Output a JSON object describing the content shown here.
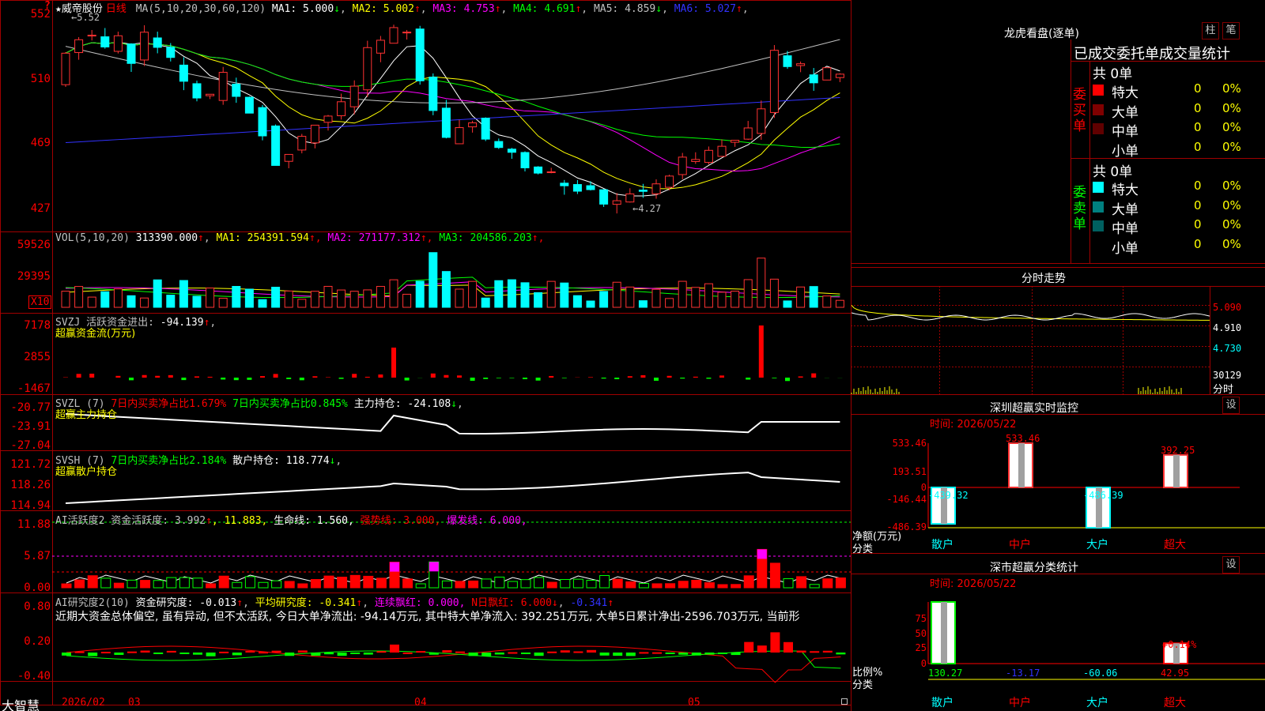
{
  "stock": {
    "star": "★",
    "name": "威帝股份",
    "period": "日线",
    "ma_header": "MA(5,10,20,30,60,120)",
    "ma": [
      {
        "label": "MA1:",
        "value": "5.000",
        "dir": "↓",
        "color": "#ffffff"
      },
      {
        "label": "MA2:",
        "value": "5.002",
        "dir": "↑",
        "color": "#ffff00"
      },
      {
        "label": "MA3:",
        "value": "4.753",
        "dir": "↑",
        "color": "#ff00ff"
      },
      {
        "label": "MA4:",
        "value": "4.691",
        "dir": "↑",
        "color": "#00ff00"
      },
      {
        "label": "MA5:",
        "value": "4.859",
        "dir": "↓",
        "color": "#c0c0c0"
      },
      {
        "label": "MA6:",
        "value": "5.027",
        "dir": "↑",
        "color": "#3232ff"
      }
    ],
    "question": "?",
    "high_label": "←5.52",
    "low_label": "←4.27",
    "axis": [
      "552",
      "510",
      "469",
      "427"
    ]
  },
  "vol": {
    "header": "VOL(5,10,20)",
    "value": "313390.000",
    "ma": [
      {
        "label": "MA1:",
        "value": "254391.594",
        "color": "#ffff00"
      },
      {
        "label": "MA2:",
        "value": "271177.312",
        "color": "#ff00ff"
      },
      {
        "label": "MA3:",
        "value": "204586.203",
        "color": "#00ff00"
      }
    ],
    "axis": [
      "59526",
      "29395"
    ],
    "unit": "X10"
  },
  "svzj": {
    "header": "SVZJ  活跃资金进出:",
    "value": "-94.139",
    "sub": "超赢资金流(万元)",
    "axis": [
      "7178",
      "2855",
      "-1467"
    ]
  },
  "svzl": {
    "header": "SVZL (7)",
    "t1": "7日内买卖净占比1.679%",
    "t2": "7日内买卖净占比0.845%",
    "t3": "主力持仓: -24.108",
    "sub": "超赢主力持仓",
    "axis": [
      "-20.77",
      "-23.91",
      "-27.04"
    ]
  },
  "svsh": {
    "header": "SVSH (7)",
    "t2": "7日内买卖净占比2.184%",
    "t3": "散户持仓: 118.774",
    "sub": "超赢散户持仓",
    "axis": [
      "121.72",
      "118.26",
      "114.94"
    ]
  },
  "ai1": {
    "header": "AI活跃度2 资金活跃度: 3.992",
    "v2": ", 11.883,",
    "v3": "生命线: 1.560,",
    "v4": "强势线: 3.000,",
    "v5": "爆发线: 6.000,",
    "axis": [
      "11.88",
      "5.87",
      "0.00"
    ]
  },
  "ai2": {
    "header": "AI研究度2(10)",
    "t1": "资金研究度: -0.013",
    "t2": "平均研究度: -0.341",
    "t3": "连续飘红: 0.000,",
    "t4": "N日飘红: 6.000",
    "t5": "-0.341",
    "text": "近期大资金总体偏空, 虽有异动, 但不太活跃, 今日大单净流出: -94.14万元, 其中特大单净流入: 392.251万元, 大单5日累计净出-2596.703万元, 当前形",
    "axis": [
      "0.80",
      "0.20",
      "-0.40"
    ]
  },
  "bottom": {
    "brand": "大智慧",
    "dates": [
      "2026/02",
      "03",
      "04",
      "05"
    ]
  },
  "right": {
    "title": "龙虎看盘(逐单)",
    "btn1": "柱",
    "btn2": "笔",
    "header": "已成交委托单成交量统计",
    "buy": {
      "title": "委买单",
      "total": "共 0单",
      "rows": [
        {
          "label": "特大",
          "count": "0",
          "pct": "0%",
          "color": "#ff0000"
        },
        {
          "label": "大单",
          "count": "0",
          "pct": "0%",
          "color": "#800000"
        },
        {
          "label": "中单",
          "count": "0",
          "pct": "0%",
          "color": "#600000"
        },
        {
          "label": "小单",
          "count": "0",
          "pct": "0%",
          "color": ""
        }
      ]
    },
    "sell": {
      "title": "委卖单",
      "total": "共 0单",
      "rows": [
        {
          "label": "特大",
          "count": "0",
          "pct": "0%",
          "color": "#00ffff"
        },
        {
          "label": "大单",
          "count": "0",
          "pct": "0%",
          "color": "#008080"
        },
        {
          "label": "中单",
          "count": "0",
          "pct": "0%",
          "color": "#006060"
        },
        {
          "label": "小单",
          "count": "0",
          "pct": "0%",
          "color": ""
        }
      ]
    },
    "intraday": {
      "title": "分时走势",
      "y": [
        "5.090",
        "4.910",
        "4.730"
      ],
      "vol": "30129",
      "unit": "分时"
    },
    "monitor": {
      "title": "深圳超赢实时监控",
      "btn": "设",
      "time": "时间: 2026/05/22",
      "y": [
        "533.46",
        "193.51",
        "0",
        "-146.44",
        "-486.39"
      ],
      "ylabel": "净额(万元)",
      "cat_label": "分类",
      "bars": [
        {
          "cat": "散户",
          "value": -439.32,
          "label": "-439.32"
        },
        {
          "cat": "中户",
          "value": 533.46,
          "label": "533.46"
        },
        {
          "cat": "大户",
          "value": -486.39,
          "label": "-486.39"
        },
        {
          "cat": "超大",
          "value": 392.25,
          "label": "392.25"
        }
      ]
    },
    "classify": {
      "title": "深市超赢分类统计",
      "btn": "设",
      "time": "时间: 2026/05/22",
      "y": [
        "75",
        "50",
        "25",
        "0"
      ],
      "ylabel": "比例%",
      "cat_label": "分类",
      "bars": [
        {
          "cat": "散户",
          "value": 130.27,
          "label": "130.27",
          "color": "#00ff00"
        },
        {
          "cat": "中户",
          "value": -13.17,
          "label": "-13.17",
          "color": "#3232ff"
        },
        {
          "cat": "大户",
          "value": -60.06,
          "label": "-60.06",
          "color": "#00ffff"
        },
        {
          "cat": "超大",
          "value": 42.95,
          "label": "42.95",
          "color": "#ff0000"
        }
      ],
      "pct_label": "+0.14%"
    }
  }
}
